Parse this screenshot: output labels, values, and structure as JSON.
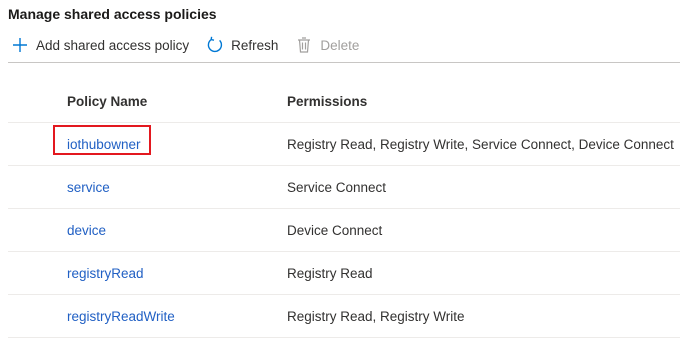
{
  "page": {
    "title": "Manage shared access policies"
  },
  "toolbar": {
    "add_label": "Add shared access policy",
    "refresh_label": "Refresh",
    "delete_label": "Delete"
  },
  "table": {
    "columns": [
      "Policy Name",
      "Permissions"
    ],
    "rows": [
      {
        "name": "iothubowner",
        "permissions": "Registry Read, Registry Write, Service Connect, Device Connect"
      },
      {
        "name": "service",
        "permissions": "Service Connect"
      },
      {
        "name": "device",
        "permissions": "Device Connect"
      },
      {
        "name": "registryRead",
        "permissions": "Registry Read"
      },
      {
        "name": "registryReadWrite",
        "permissions": "Registry Read, Registry Write"
      }
    ]
  },
  "colors": {
    "link": "#2160c4",
    "highlight": "#e3181f",
    "accent": "#0078d4"
  },
  "icons": {
    "add": "plus-icon",
    "refresh": "refresh-icon",
    "delete": "trash-icon"
  }
}
